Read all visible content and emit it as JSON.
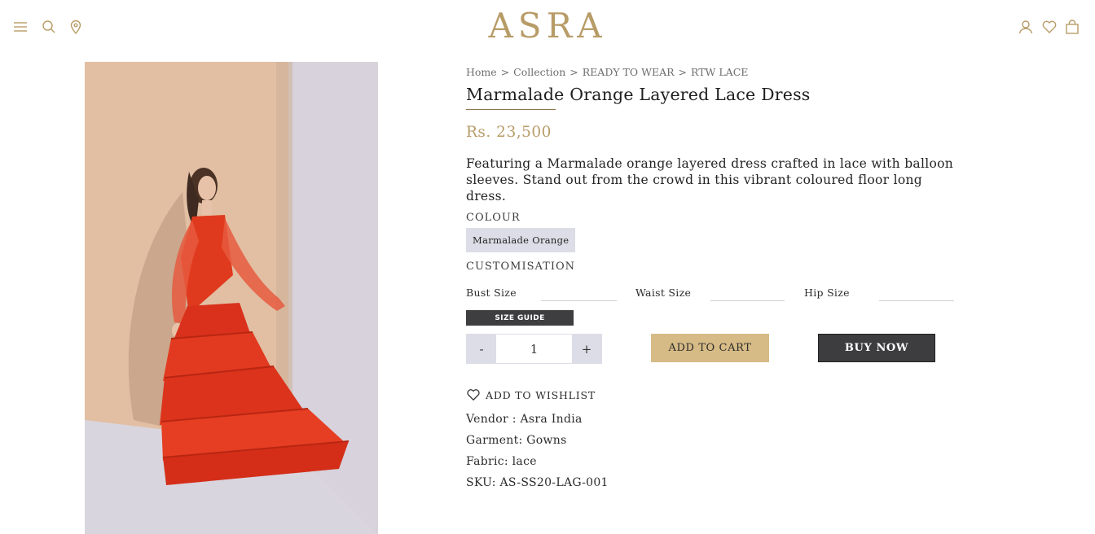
{
  "header": {
    "logo_text": "ASRA",
    "icons": [
      "menu-icon",
      "search-icon",
      "location-icon",
      "account-icon",
      "wishlist-icon",
      "cart-icon"
    ],
    "accent_color": "#b89c67"
  },
  "breadcrumb": [
    "Home",
    "Collection",
    "READY TO WEAR",
    "RTW LACE"
  ],
  "breadcrumb_separator": ">",
  "product": {
    "title": "Marmalade Orange Layered Lace Dress",
    "price": "Rs. 23,500",
    "description": "Featuring a Marmalade orange layered dress crafted in lace with balloon sleeves. Stand out from the crowd in this vibrant coloured floor long dress.",
    "colour_label": "COLOUR",
    "colour_option": "Marmalade Orange",
    "customisation_label": "CUSTOMISATION",
    "sizes": {
      "bust": "Bust Size",
      "waist": "Waist Size",
      "hip": "Hip Size"
    },
    "size_guide_label": "SIZE GUIDE",
    "quantity": {
      "minus": "-",
      "value": "1",
      "plus": "+"
    },
    "add_to_cart_label": "ADD TO CART",
    "buy_now_label": "BUY NOW",
    "wishlist_label": "ADD TO WISHLIST",
    "meta": {
      "vendor": "Vendor : Asra India",
      "garment": "Garment: Gowns",
      "fabric": "Fabric: lace",
      "sku": "SKU: AS-SS20-LAG-001"
    }
  },
  "colors": {
    "gold": "#b89c67",
    "button_gold": "#d6bb86",
    "dark_button": "#3d3d3f",
    "swatch_bg": "#dcdde7",
    "dress": "#e2361c"
  }
}
